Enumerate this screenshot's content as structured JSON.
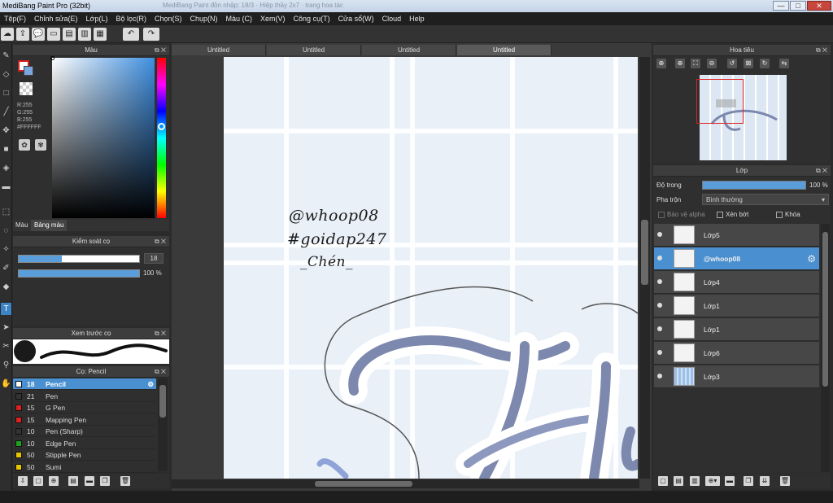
{
  "window": {
    "title": "MediBang Paint Pro (32bit)",
    "ghost_tabs": "MediBang Paint đồn nhập: 18/3 · Hiệp thầy 2x7 · trang hoa tác",
    "min_label": "—",
    "max_label": "□",
    "close_label": "✕"
  },
  "menu": [
    "Tệp(F)",
    "Chỉnh sửa(E)",
    "Lớp(L)",
    "Bộ lọc(R)",
    "Chọn(S)",
    "Chụp(N)",
    "Màu (C)",
    "Xem(V)",
    "Công cụ(T)",
    "Cửa sổ(W)",
    "Cloud",
    "Help"
  ],
  "toolbar": {
    "undo_icon": "↶",
    "redo_icon": "↷"
  },
  "color_panel": {
    "title": "Màu",
    "r": "R:255",
    "g": "G:255",
    "b": "B:255",
    "hex": "#FFFFFF",
    "tab_color": "Màu",
    "tab_palette": "Bảng màu"
  },
  "brush_control": {
    "title": "Kiểm soát cọ",
    "size_value": "18",
    "opacity_value": "100 %",
    "size_fraction": 0.36,
    "opacity_fraction": 1.0
  },
  "brush_preview": {
    "title": "Xem trước cọ"
  },
  "brush_list": {
    "title": "Cọ: Pencil",
    "items": [
      {
        "size": "18",
        "name": "Pencil",
        "color": "#ffffff",
        "selected": true
      },
      {
        "size": "21",
        "name": "Pen",
        "color": "#333333",
        "selected": false
      },
      {
        "size": "15",
        "name": "G Pen",
        "color": "#e02020",
        "selected": false
      },
      {
        "size": "15",
        "name": "Mapping Pen",
        "color": "#e02020",
        "selected": false
      },
      {
        "size": "10",
        "name": "Pen (Sharp)",
        "color": "#333333",
        "selected": false
      },
      {
        "size": "10",
        "name": "Edge Pen",
        "color": "#1fa01f",
        "selected": false
      },
      {
        "size": "50",
        "name": "Stipple Pen",
        "color": "#e6c600",
        "selected": false
      },
      {
        "size": "50",
        "name": "Sumi",
        "color": "#e6c600",
        "selected": false
      }
    ]
  },
  "doc_tabs": [
    "Untitled",
    "Untitled",
    "Untitled",
    "Untitled"
  ],
  "canvas": {
    "line1": "@whoop08",
    "line2": "#goidap247",
    "line3": "_Chén_",
    "grid_color": "#ffffff",
    "bg_color": "#e9f0f7",
    "stroke_color": "#7c88ad"
  },
  "navigator": {
    "title": "Hoa tiêu"
  },
  "layer_panel": {
    "title": "Lớp",
    "opacity_label": "Độ trong",
    "opacity_value": "100 %",
    "blend_label": "Pha trộn",
    "blend_value": "Bình thường",
    "protect_alpha": "Bảo vệ alpha",
    "clipping": "Xén bớt",
    "lock": "Khóa",
    "layers": [
      {
        "name": "Lớp5",
        "selected": false
      },
      {
        "name": "@whoop08",
        "selected": true
      },
      {
        "name": "Lớp4",
        "selected": false
      },
      {
        "name": "Lớp1",
        "selected": false
      },
      {
        "name": "Lớp1",
        "selected": false
      },
      {
        "name": "Lớp6",
        "selected": false
      },
      {
        "name": "Lớp3",
        "selected": false
      }
    ]
  }
}
